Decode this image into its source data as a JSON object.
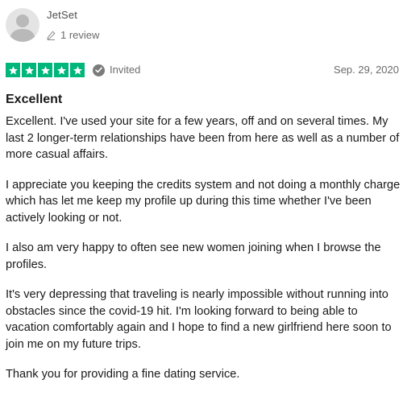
{
  "reviewer": {
    "name": "JetSet",
    "review_count": "1 review"
  },
  "rating": {
    "stars": 5,
    "max_stars": 5,
    "star_color": "#00b67a"
  },
  "badge": {
    "label": "Invited"
  },
  "date": "Sep. 29, 2020",
  "review": {
    "title": "Excellent",
    "paragraphs": [
      "Excellent. I've used your site for a few years, off and on several times. My last 2 longer-term relationships have been from here as well as a number of more casual affairs.",
      "I appreciate you keeping the credits system and not doing a monthly charge which has let me keep my profile up during this time whether I've been actively looking or not.",
      "I also am very happy to often see new women joining when I browse the profiles.",
      "It's very depressing that traveling is nearly impossible without running into obstacles since the covid-19 hit. I'm looking forward to being able to vacation comfortably again and I hope to find a new girlfriend here soon to join me on my future trips.",
      "Thank you for providing a fine dating service."
    ]
  },
  "icons": {
    "avatar": "user-silhouette-icon",
    "review_count": "pencil-icon",
    "star": "star-icon",
    "invited": "check-circle-icon"
  }
}
